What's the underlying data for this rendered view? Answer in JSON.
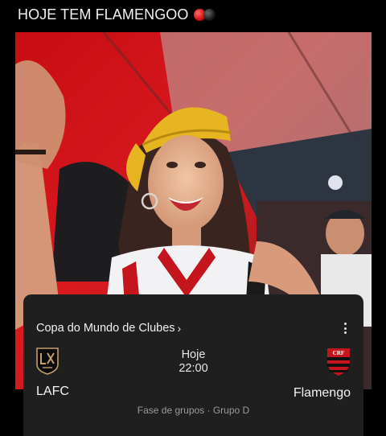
{
  "caption": {
    "text": "HOJE TEM FLAMENGOO",
    "emoji": [
      "red-circle-icon",
      "black-circle-icon"
    ]
  },
  "photo": {
    "subject": "fan-photo"
  },
  "match_card": {
    "competition": "Copa do Mundo de Clubes",
    "chevron": "›",
    "menu_icon": "more-vert-icon",
    "home_team": {
      "name": "LAFC",
      "crest": "lafc-crest-icon"
    },
    "away_team": {
      "name": "Flamengo",
      "crest": "flamengo-crest-icon"
    },
    "day": "Hoje",
    "time": "22:00",
    "stage": "Fase de grupos · Grupo D"
  },
  "colors": {
    "card_bg": "#1f1f1f",
    "accent_red": "#d10f0f",
    "lafc_gold": "#c39e6d"
  }
}
